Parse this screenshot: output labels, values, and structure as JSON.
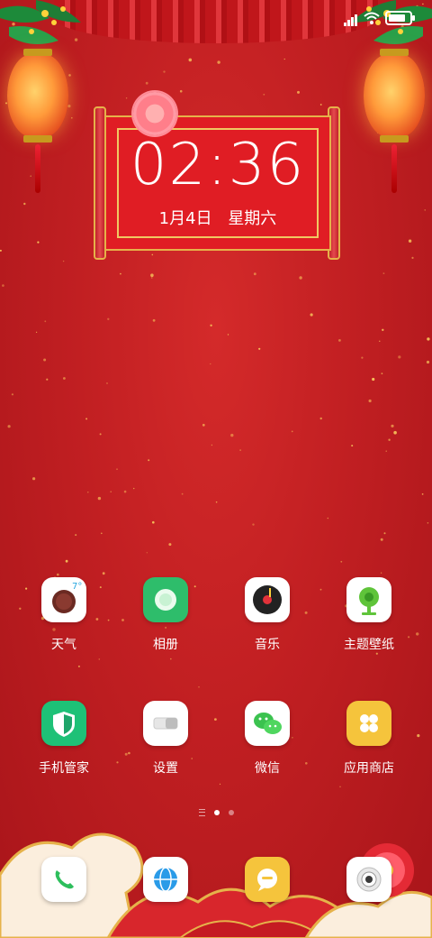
{
  "status_bar": {
    "signal_icon": "signal-icon",
    "wifi_icon": "wifi-icon",
    "battery_icon": "battery-charging-icon",
    "battery_level": 0.8
  },
  "clock": {
    "time": "02:36",
    "date": "1月4日",
    "weekday": "星期六"
  },
  "apps": [
    {
      "name": "天气",
      "icon": "weather-icon",
      "badge": "7°"
    },
    {
      "name": "相册",
      "icon": "gallery-icon"
    },
    {
      "name": "音乐",
      "icon": "music-icon"
    },
    {
      "name": "主题壁纸",
      "icon": "themes-icon"
    },
    {
      "name": "手机管家",
      "icon": "security-icon"
    },
    {
      "name": "设置",
      "icon": "settings-icon"
    },
    {
      "name": "微信",
      "icon": "wechat-icon"
    },
    {
      "name": "应用商店",
      "icon": "app-store-icon"
    }
  ],
  "page_indicator": {
    "pages": 2,
    "current": 1
  },
  "dock": [
    {
      "icon": "phone-icon"
    },
    {
      "icon": "browser-icon"
    },
    {
      "icon": "messages-icon"
    },
    {
      "icon": "camera-icon"
    }
  ],
  "colors": {
    "background": "#c11f22",
    "gold": "#e6b24a",
    "app_label": "#ffffff"
  }
}
